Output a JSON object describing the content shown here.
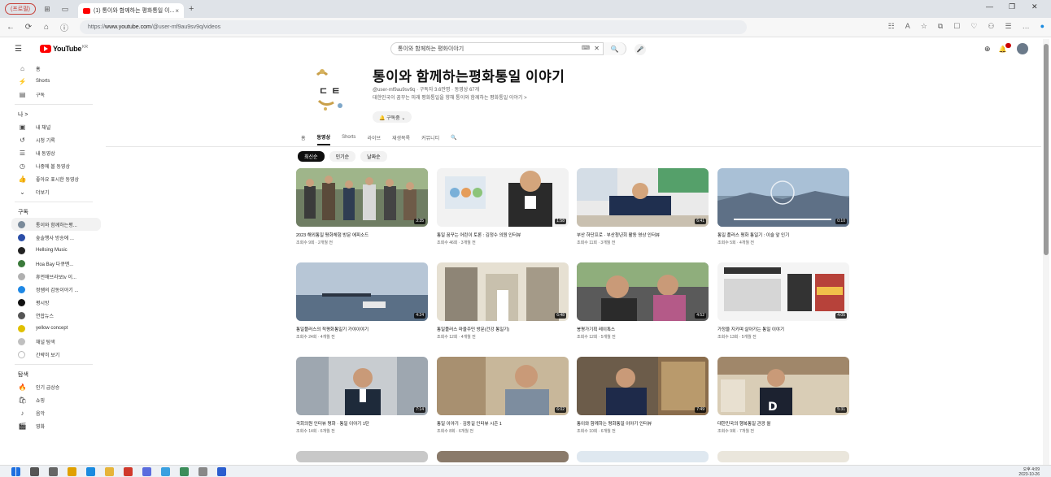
{
  "browser": {
    "profile_label": "(프로필)",
    "tab_title": "(1) 통이와 함께하는 평화통일 이...",
    "tab_close": "×",
    "new_tab": "+",
    "url_prefix": "https://",
    "url_domain": "www.youtube.com",
    "url_path": "/@user-mf9au9sv9q/videos",
    "window_controls": [
      "—",
      "❐",
      "✕"
    ],
    "nav": [
      "←",
      "⟳",
      "⌂",
      "ⓘ"
    ],
    "toolbar_icons": [
      "☷",
      "A",
      "☆",
      "⧉",
      "☐",
      "♡",
      "⚇",
      "☰",
      "…"
    ]
  },
  "masthead": {
    "menu": "☰",
    "logo_text": "YouTube",
    "logo_suffix": "KR",
    "search_value": "통이와 함께하는 평화이야기",
    "search_kbd": "⌨",
    "search_clear": "✕",
    "search_button": "🔍",
    "mic": "🎤",
    "create": "⊕"
  },
  "sidebar": {
    "top": [
      {
        "icon": "⌂",
        "label": "홈"
      },
      {
        "icon": "⚡",
        "label": "Shorts"
      },
      {
        "icon": "▤",
        "label": "구독"
      }
    ],
    "you_header": "나  >",
    "you": [
      {
        "icon": "▣",
        "label": "내 채널"
      },
      {
        "icon": "↺",
        "label": "시청 기록"
      },
      {
        "icon": "☰",
        "label": "내 동영상"
      },
      {
        "icon": "◷",
        "label": "나중에 볼 동영상"
      },
      {
        "icon": "👍",
        "label": "좋아요 표시한 동영상"
      },
      {
        "icon": "⌄",
        "label": "더보기"
      }
    ],
    "subs_header": "구독",
    "subs": [
      {
        "color": "#7a8a9a",
        "label": "통이와 함께하는평..."
      },
      {
        "color": "#2b4ea8",
        "label": "숲솔행사 방송에 ..."
      },
      {
        "color": "#222222",
        "label": "Hellsing Music"
      },
      {
        "color": "#3b7a3b",
        "label": "Hoa Bay 다큐멘..."
      },
      {
        "color": "#b0b0b0",
        "label": "휴먼애브라보tv 이..."
      },
      {
        "color": "#1e88e5",
        "label": "정쌤의 감동이야기 ..."
      },
      {
        "color": "#111111",
        "label": "평시방"
      },
      {
        "color": "#555555",
        "label": "연합뉴스"
      },
      {
        "color": "#e0c000",
        "label": "yellow concept"
      },
      {
        "color": "#c0c0c0",
        "label": "채널 탐색"
      },
      {
        "color": "#ffffff",
        "label": "간략히 보기"
      }
    ],
    "explore_header": "탐색",
    "explore": [
      {
        "icon": "🔥",
        "label": "인기 급상승"
      },
      {
        "icon": "🛍",
        "label": "쇼핑"
      },
      {
        "icon": "♪",
        "label": "음악"
      },
      {
        "icon": "🎬",
        "label": "영화"
      }
    ]
  },
  "channel": {
    "name": "통이와 함께하는평화통일 이야기",
    "meta": "@user-mf9au9sv9q · 구독자 3.6만명 · 동영상 67개",
    "description": "대한민국이 꿈꾸는 미래 평화통일을 향해 통이와 함께하는 평화통일 이야기 >",
    "subscribe_label": "🔔 구독중 ⌄"
  },
  "tabs": [
    "홈",
    "동영상",
    "Shorts",
    "라이브",
    "재생목록",
    "커뮤니티",
    "🔍"
  ],
  "active_tab": 1,
  "chips": [
    "최신순",
    "인기순",
    "날짜순"
  ],
  "videos": [
    {
      "title": "2023 해외통일 평화체험 방문 에피소드",
      "meta": "조회수 9회 · 2개월 전",
      "duration": "3:35"
    },
    {
      "title": "통일 꿈꾸는 어린이 토론 : 김정수 의원 인터뷰",
      "meta": "조회수 46회 · 3개월 전",
      "duration": "1:58"
    },
    {
      "title": "부산 하단프로 · 부산청년회 활동 영상 인터뷰",
      "meta": "조회수 11회 · 3개월 전",
      "duration": "6:41"
    },
    {
      "title": "통일 플러스 평화 통일기 : 이슬 앞 인기",
      "meta": "조회수 5회 · 4개월 전",
      "duration": "0:10"
    },
    {
      "title": "통일플러스의 적평화통일기 가야이야기",
      "meta": "조회수 24회 · 4개월 전",
      "duration": "4:24"
    },
    {
      "title": "통일플러스 마을주민 방문(건강 통일기)",
      "meta": "조회수 12회 · 4개월 전",
      "duration": "6:48"
    },
    {
      "title": "봉평가기획 레이톡스",
      "meta": "조회수 12회 · 5개월 전",
      "duration": "4:52"
    },
    {
      "title": "가정을 지키며 살아가는 통일 이야기",
      "meta": "조회수 13회 · 5개월 전",
      "duration": "4:05"
    },
    {
      "title": "국회의원 인터뷰 평화 · 통일 이야기 1탄",
      "meta": "조회수 14회 · 6개월 전",
      "duration": "7:14"
    },
    {
      "title": "통일 이야기 · 김동길 인터뷰 시즌 1",
      "meta": "조회수 8회 · 6개월 전",
      "duration": "6:02"
    },
    {
      "title": "통이와 함께하는 평화통일 이야기 인터뷰",
      "meta": "조회수 10회 · 6개월 전",
      "duration": "7:49"
    },
    {
      "title": "대한민국의 행복통일 관광 월",
      "meta": "조회수 9회 · 7개월 전",
      "duration": "5:31"
    }
  ],
  "taskbar": {
    "clock_time": "오후 4:09",
    "clock_date": "2023-10-26"
  }
}
